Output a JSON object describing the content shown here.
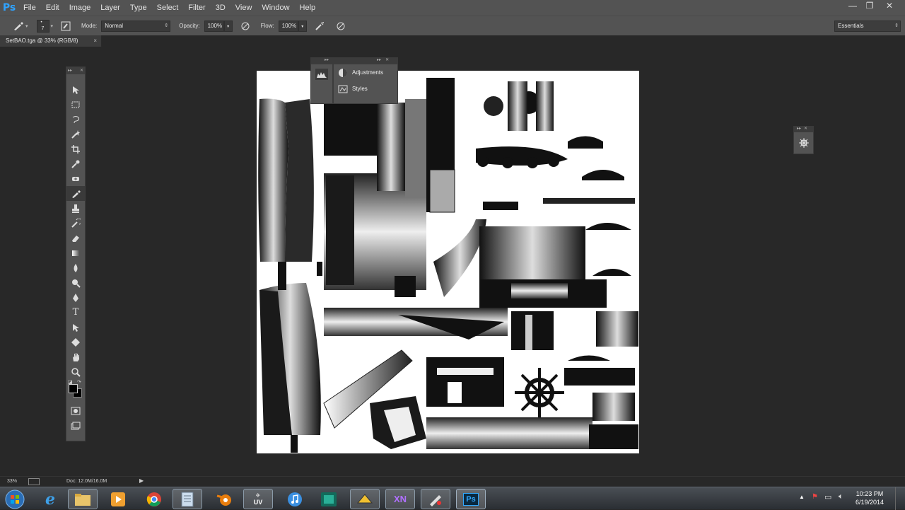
{
  "app": {
    "logo": "Ps",
    "accent_color": "#2fa3ff"
  },
  "menu": [
    "File",
    "Edit",
    "Image",
    "Layer",
    "Type",
    "Select",
    "Filter",
    "3D",
    "View",
    "Window",
    "Help"
  ],
  "window_controls": {
    "minimize": "—",
    "restore": "❐",
    "close": "✕"
  },
  "options_bar": {
    "brush_size": "7",
    "mode_label": "Mode:",
    "mode_value": "Normal",
    "opacity_label": "Opacity:",
    "opacity_value": "100%",
    "flow_label": "Flow:",
    "flow_value": "100%",
    "workspace": "Essentials"
  },
  "document_tab": {
    "title": "SetBAO.tga @ 33% (RGB/8)",
    "close": "×"
  },
  "floating_panel": {
    "items": [
      {
        "label": "Adjustments",
        "icon": "adjustments-icon"
      },
      {
        "label": "Styles",
        "icon": "styles-icon"
      }
    ]
  },
  "status_bar": {
    "zoom": "33%",
    "doc_info": "Doc: 12.0M/16.0M"
  },
  "taskbar": {
    "apps": [
      "start",
      "internet-explorer",
      "file-explorer",
      "media-player",
      "chrome",
      "notepad",
      "blender",
      "uv-layout",
      "itunes",
      "photoshop-alt",
      "sketch",
      "xnview",
      "paint-tool",
      "photoshop"
    ],
    "uv_label": "UV",
    "xn_label": "XN",
    "ps_label": "Ps",
    "time": "10:23 PM",
    "date": "6/19/2014"
  }
}
